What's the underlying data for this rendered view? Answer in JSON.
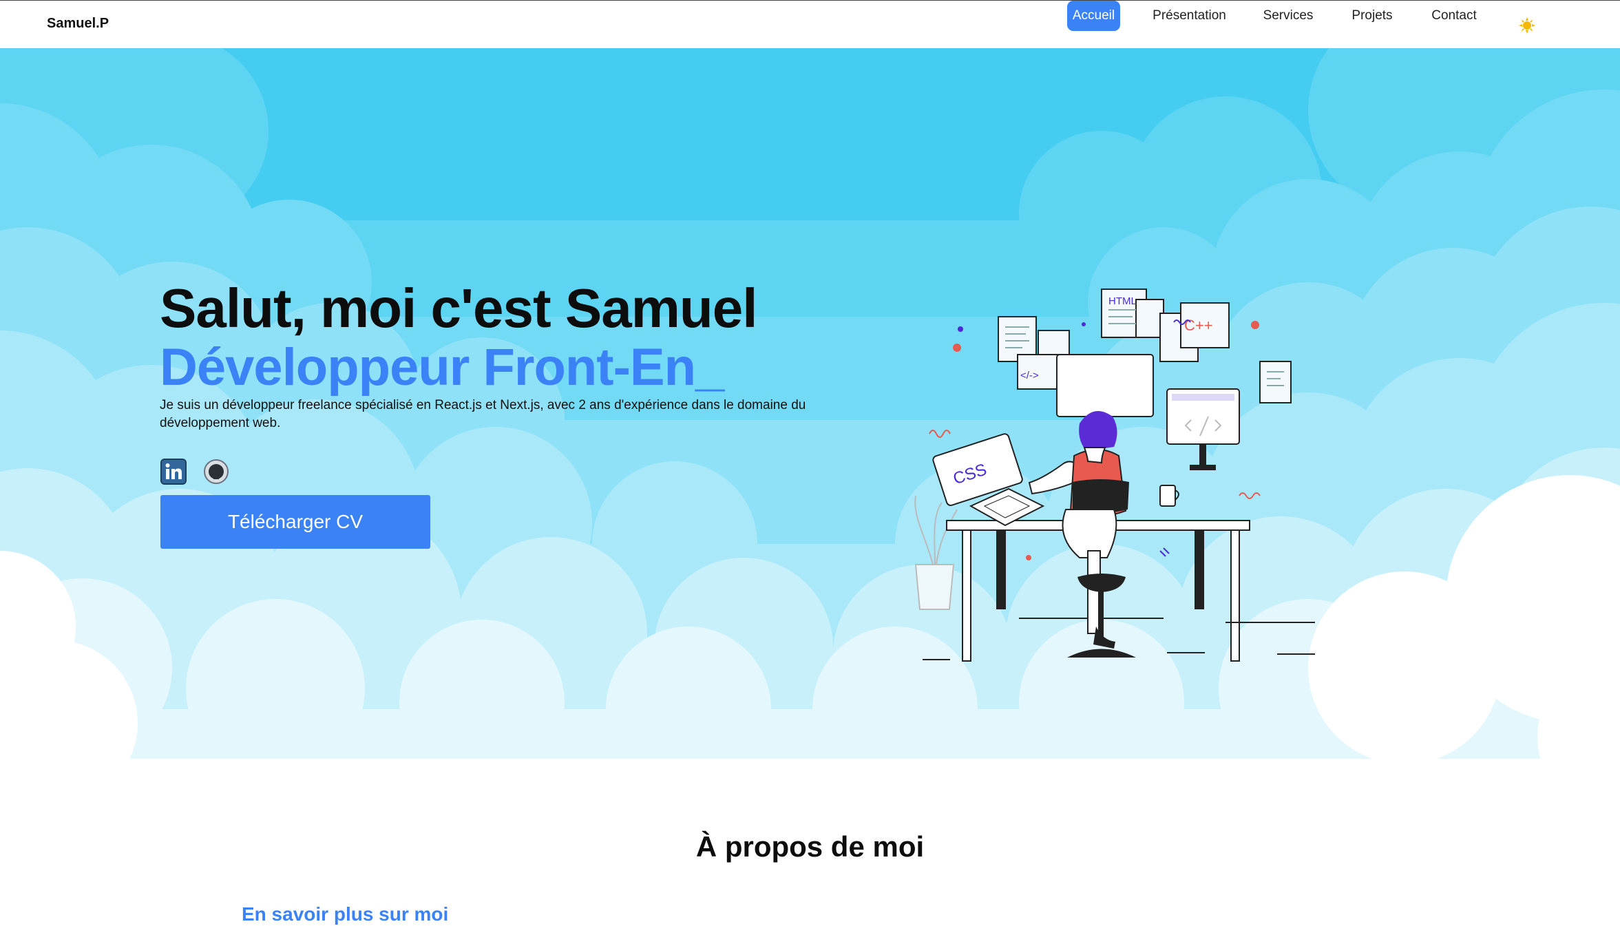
{
  "nav": {
    "brand": "Samuel.P",
    "items": [
      {
        "label": "Accueil",
        "active": true
      },
      {
        "label": "Présentation",
        "active": false
      },
      {
        "label": "Services",
        "active": false
      },
      {
        "label": "Projets",
        "active": false
      },
      {
        "label": "Contact",
        "active": false
      }
    ],
    "theme_toggle_icon": "sun-icon"
  },
  "hero": {
    "title": "Salut, moi c'est Samuel",
    "subtitle": "Développeur Front-En_",
    "description": "Je suis un développeur freelance spécialisé en React.js et Next.js, avec 2 ans d'expérience dans le domaine du développement web.",
    "socials": [
      {
        "icon": "linkedin-icon"
      },
      {
        "icon": "github-icon"
      }
    ],
    "cv_button": "Télécharger CV",
    "illustration_labels": {
      "css": "CSS",
      "html": "HTML",
      "cpp": "C++",
      "tag": "</->"
    }
  },
  "about": {
    "title": "À propos de moi",
    "subtitle": "En savoir plus sur moi"
  },
  "colors": {
    "accent": "#3b82f6",
    "sky": "#44cdf0",
    "sun": "#f5b800"
  }
}
